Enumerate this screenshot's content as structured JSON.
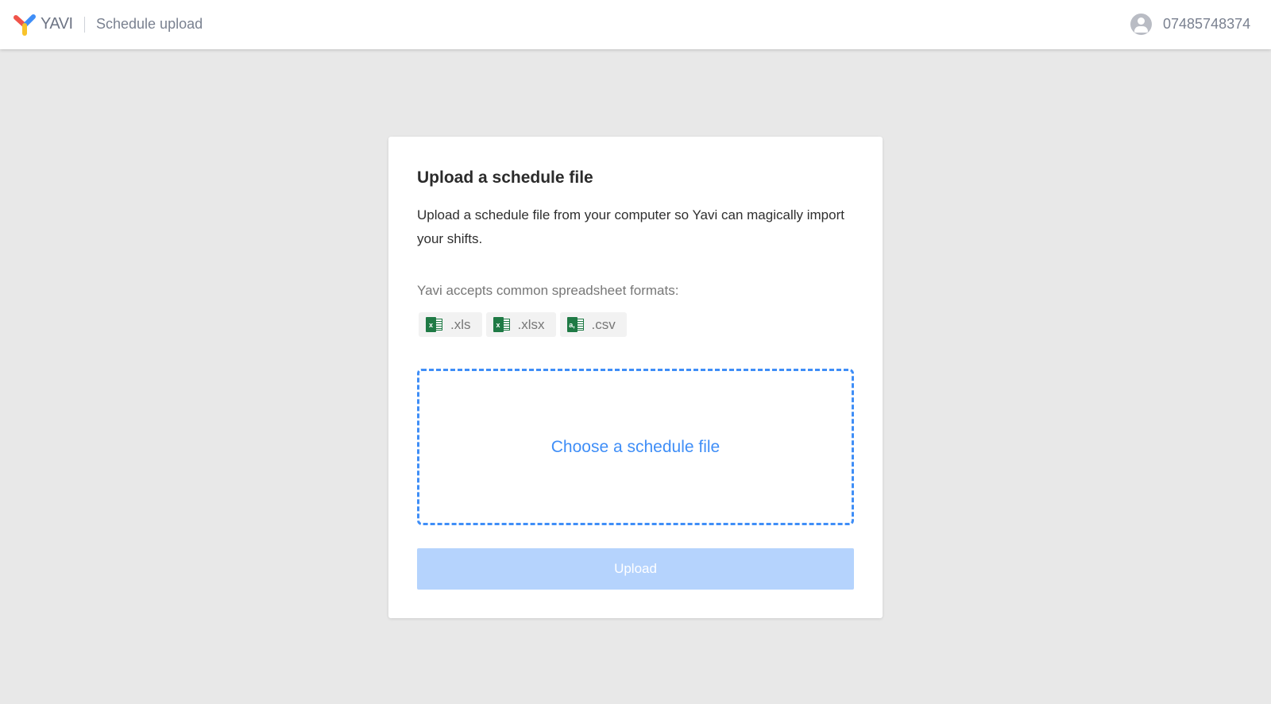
{
  "header": {
    "brand": "YAVI",
    "page_title": "Schedule upload",
    "user_phone": "07485748374"
  },
  "card": {
    "title": "Upload a schedule file",
    "description": "Upload a schedule file from your computer so Yavi can magically import your shifts.",
    "accepts_label": "Yavi accepts common spreadsheet formats:",
    "formats": [
      {
        "label": ".xls",
        "icon": "excel-icon",
        "glyph": "x"
      },
      {
        "label": ".xlsx",
        "icon": "excel-icon",
        "glyph": "x"
      },
      {
        "label": ".csv",
        "icon": "csv-icon",
        "glyph": "a,"
      }
    ],
    "dropzone_label": "Choose a schedule file",
    "upload_label": "Upload"
  },
  "colors": {
    "accent": "#3f8ef7",
    "button_disabled": "#b5d3fd",
    "excel_green": "#1f7a45"
  }
}
